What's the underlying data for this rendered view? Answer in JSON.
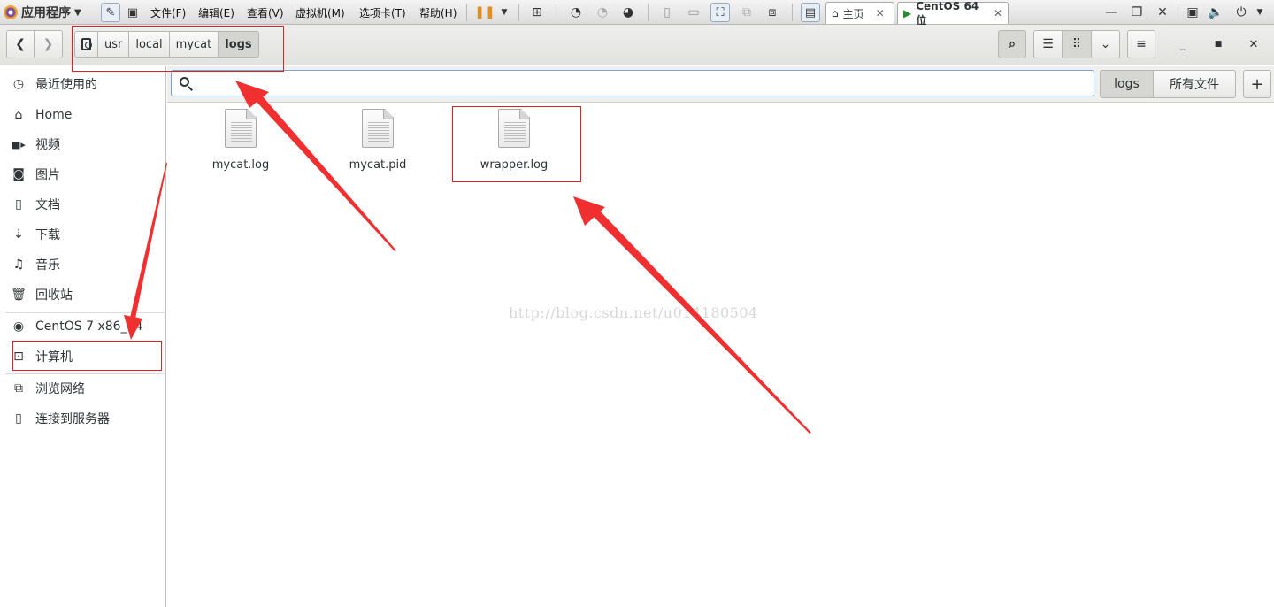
{
  "topbar": {
    "apps_label": "应用程序",
    "menu": [
      "文件(F)",
      "编辑(E)",
      "查看(V)",
      "虚拟机(M)",
      "选项卡(T)",
      "帮助(H)"
    ],
    "tabs": [
      {
        "label": "主页",
        "icon": "home-icon"
      },
      {
        "label": "CentOS 64 位",
        "icon": "vm-icon"
      }
    ]
  },
  "breadcrumbs": [
    "usr",
    "local",
    "mycat",
    "logs"
  ],
  "search": {
    "value": "",
    "placeholder": ""
  },
  "scope_buttons": [
    "logs",
    "所有文件"
  ],
  "sidebar": {
    "places": [
      {
        "label": "最近使用的",
        "icon": "clock-icon"
      },
      {
        "label": "Home",
        "icon": "home-icon"
      },
      {
        "label": "视频",
        "icon": "video-icon"
      },
      {
        "label": "图片",
        "icon": "camera-icon"
      },
      {
        "label": "文档",
        "icon": "document-icon"
      },
      {
        "label": "下载",
        "icon": "download-icon"
      },
      {
        "label": "音乐",
        "icon": "music-icon"
      },
      {
        "label": "回收站",
        "icon": "trash-icon"
      }
    ],
    "devices": [
      {
        "label": "CentOS 7 x86_64",
        "icon": "disc-icon"
      },
      {
        "label": "计算机",
        "icon": "computer-icon"
      }
    ],
    "network": [
      {
        "label": "浏览网络",
        "icon": "network-icon"
      },
      {
        "label": "连接到服务器",
        "icon": "server-icon"
      }
    ]
  },
  "files": [
    {
      "name": "mycat.log"
    },
    {
      "name": "mycat.pid"
    },
    {
      "name": "wrapper.log"
    }
  ],
  "watermark": "http://blog.csdn.net/u014180504",
  "colors": {
    "annotation": "#e02020",
    "search_border": "#7ea3cf"
  }
}
